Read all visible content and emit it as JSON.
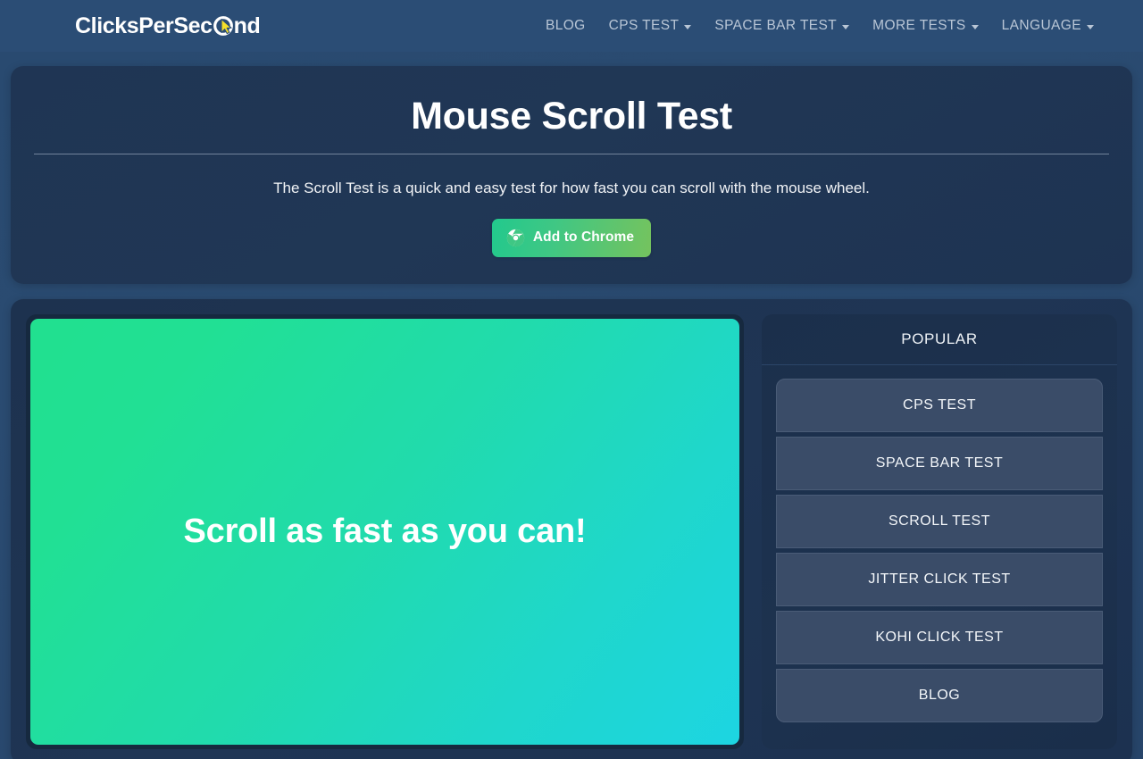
{
  "navbar": {
    "logo": {
      "text_before": "ClicksPerSec",
      "text_after": "nd",
      "icon": "cursor-arrow-in-o-icon"
    },
    "links": [
      {
        "label": "BLOG",
        "has_caret": false
      },
      {
        "label": "CPS TEST",
        "has_caret": true
      },
      {
        "label": "SPACE BAR TEST",
        "has_caret": true
      },
      {
        "label": "MORE TESTS",
        "has_caret": true
      },
      {
        "label": "LANGUAGE",
        "has_caret": true
      }
    ]
  },
  "hero": {
    "title": "Mouse Scroll Test",
    "subtitle": "The Scroll Test is a quick and easy test for how fast you can scroll with the mouse wheel.",
    "cta": {
      "label": "Add to Chrome",
      "icon": "chrome-icon"
    }
  },
  "main": {
    "scroll_area": {
      "message": "Scroll as fast as you can!"
    }
  },
  "sidebar": {
    "header": "POPULAR",
    "items": [
      {
        "label": "CPS TEST"
      },
      {
        "label": "SPACE BAR TEST"
      },
      {
        "label": "SCROLL TEST"
      },
      {
        "label": "JITTER CLICK TEST"
      },
      {
        "label": "KOHI CLICK TEST"
      },
      {
        "label": "BLOG"
      }
    ]
  },
  "colors": {
    "nav_bg": "#2b4d75",
    "page_bg": "#294a70",
    "card_bg": "#1f3554",
    "scroll_start": "#21e08f",
    "scroll_end": "#1dd5e2",
    "cta_start": "#22c98d",
    "cta_end": "#75c35e",
    "sidebar_item": "#3a4c68",
    "logo_cursor": "#f5e02a"
  }
}
